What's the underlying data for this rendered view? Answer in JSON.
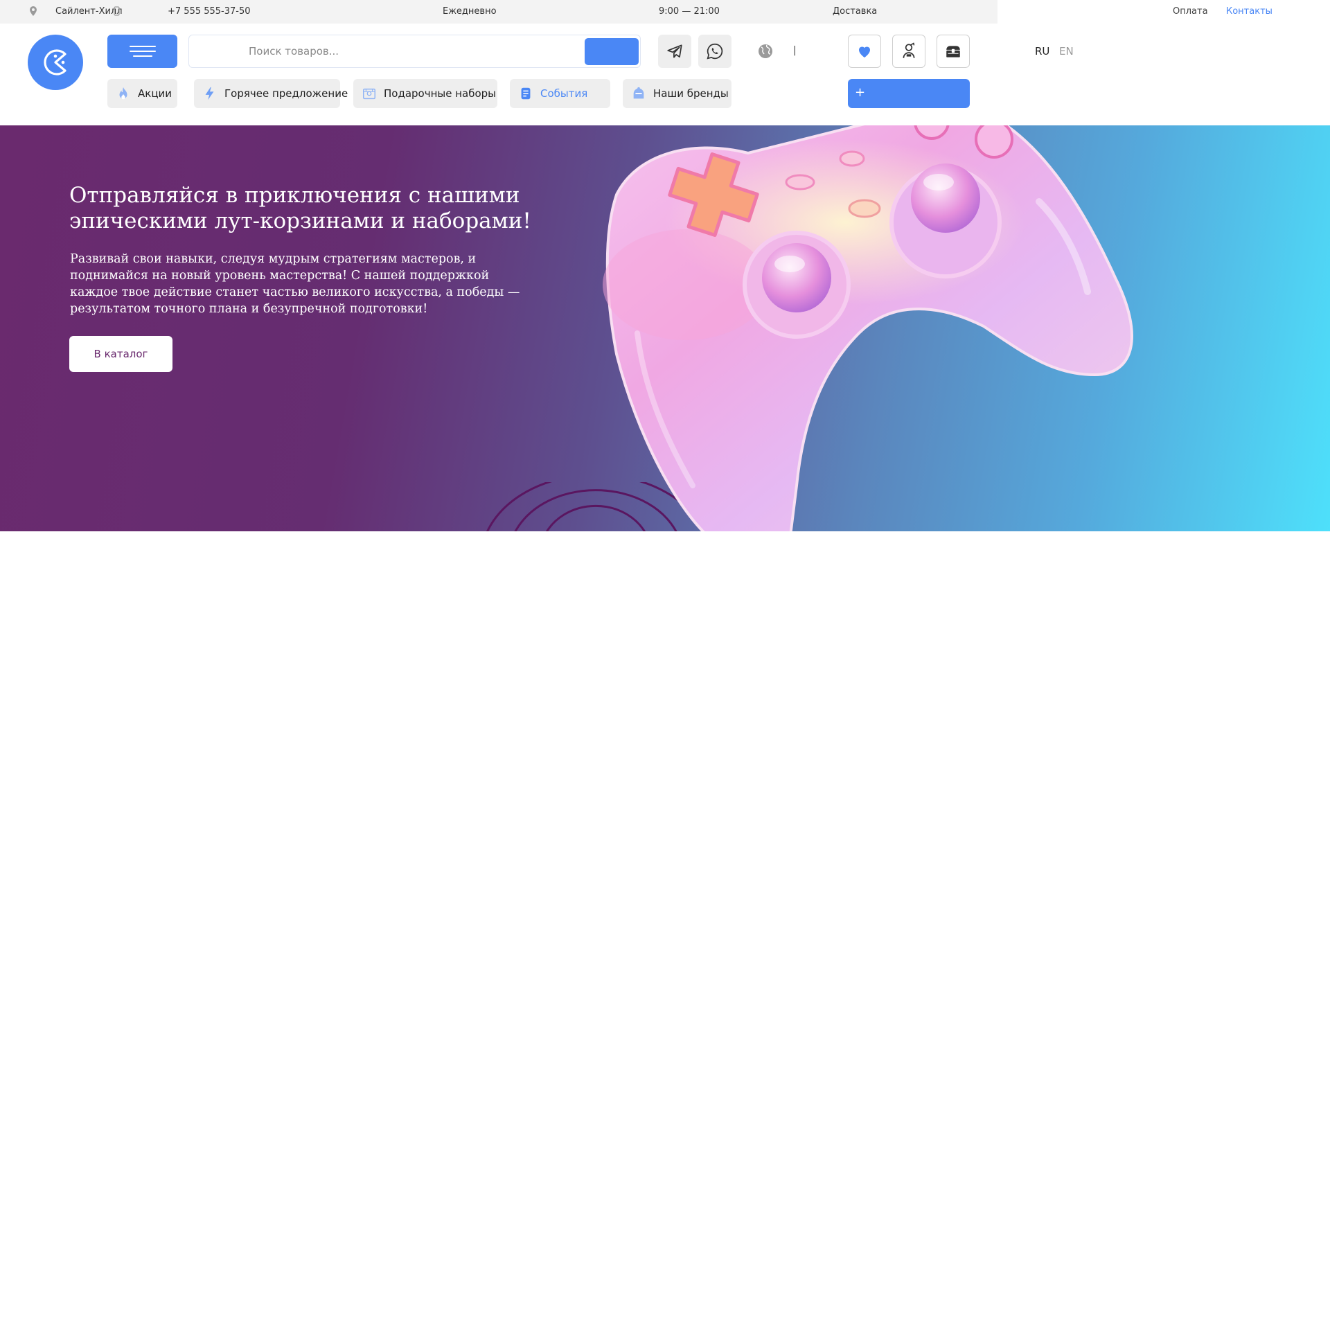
{
  "topbar": {
    "city": "Сайлент-Хилл",
    "phone": "+7 555 555-37-50",
    "schedule_label": "Ежедневно",
    "hours": "9:00 — 21:00",
    "links": [
      "Доставка",
      "Оплата",
      "Контакты"
    ]
  },
  "header": {
    "search_placeholder": "Поиск товаров...",
    "separator": "|",
    "langs": [
      "RU",
      "EN"
    ],
    "add_label": "+",
    "nav": [
      {
        "label": "Акции",
        "icon": "fire-icon"
      },
      {
        "label": "Горячее предложение",
        "icon": "lightning-icon"
      },
      {
        "label": "Подарочные наборы",
        "icon": "gift-box-icon"
      },
      {
        "label": "События",
        "icon": "scroll-icon",
        "active": true
      },
      {
        "label": "Наши бренды",
        "icon": "knight-helmet-icon"
      }
    ]
  },
  "hero": {
    "title": "Отправляйся в приключения с нашими эпическими лут-корзинами и наборами!",
    "text": "Развивай свои навыки, следуя мудрым стратегиям мастеров, и поднимайся на новый уровень мастерства! С нашей поддержкой каждое твое действие станет частью великого искусства, а победы — результатом точного плана и безупречной подготовки!",
    "cta": "В каталог"
  },
  "colors": {
    "accent": "#4a87f5",
    "hero_start": "#6a2a6e",
    "hero_end": "#4ee0fb",
    "link_active": "#4a87f5"
  }
}
